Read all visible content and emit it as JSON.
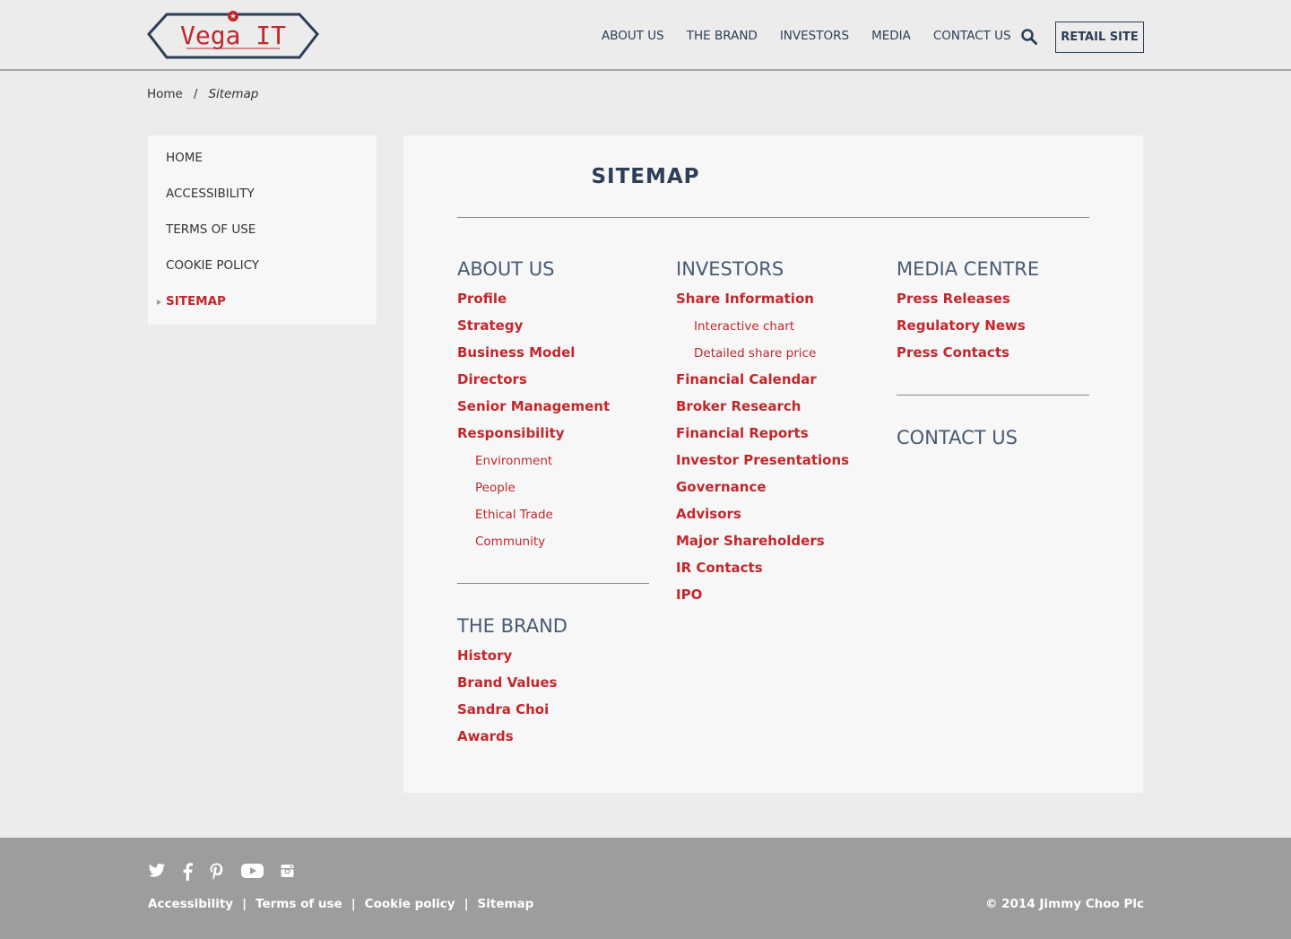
{
  "header": {
    "logo_text": "Vega IT",
    "nav": [
      "ABOUT US",
      "THE BRAND",
      "INVESTORS",
      "MEDIA",
      "CONTACT US"
    ],
    "search_icon": "search-icon",
    "retail_button": "RETAIL SITE"
  },
  "breadcrumb": {
    "home": "Home",
    "separator": "/",
    "current": "Sitemap"
  },
  "sidebar": {
    "items": [
      "HOME",
      "ACCESSIBILITY",
      "TERMS OF USE",
      "COOKIE POLICY",
      "SITEMAP"
    ],
    "active_index": 4
  },
  "main": {
    "title": "SITEMAP",
    "about": {
      "heading": "ABOUT US",
      "links": [
        "Profile",
        "Strategy",
        "Business Model",
        "Directors",
        "Senior Management",
        "Responsibility"
      ],
      "sublinks": [
        "Environment",
        "People",
        "Ethical Trade",
        "Community"
      ]
    },
    "brand": {
      "heading": "THE BRAND",
      "links": [
        "History",
        "Brand Values",
        "Sandra Choi",
        "Awards"
      ]
    },
    "investors": {
      "heading": "INVESTORS",
      "first_link": "Share Information",
      "sublinks": [
        "Interactive chart",
        "Detailed share price"
      ],
      "links": [
        "Financial Calendar",
        "Broker Research",
        "Financial Reports",
        "Investor Presentations",
        "Governance",
        "Advisors",
        "Major Shareholders",
        "IR Contacts",
        "IPO"
      ]
    },
    "media": {
      "heading": "MEDIA CENTRE",
      "links": [
        "Press Releases",
        "Regulatory News",
        "Press Contacts"
      ]
    },
    "contact": {
      "heading": "CONTACT US"
    }
  },
  "footer": {
    "social_icons": [
      "twitter-icon",
      "facebook-icon",
      "pinterest-icon",
      "youtube-icon",
      "instagram-icon"
    ],
    "links": [
      "Accessibility",
      "Terms of use",
      "Cookie policy",
      "Sitemap"
    ],
    "separator": "|",
    "copyright": "© 2014 Jimmy Choo Plc"
  },
  "colors": {
    "accent_red": "#c0282d",
    "navy": "#2d3e56",
    "footer_gray": "#9d9d9d",
    "background": "#ececec"
  }
}
